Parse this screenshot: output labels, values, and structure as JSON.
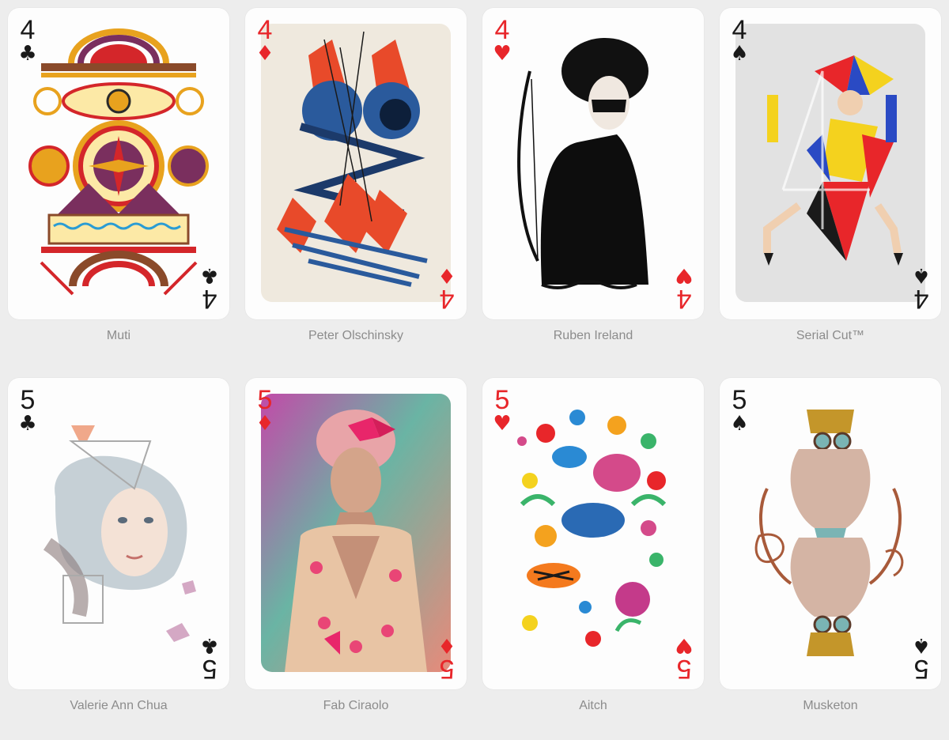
{
  "colors": {
    "red": "#e8262a",
    "black": "#1a1a1a",
    "caption": "#8c8c8c",
    "background": "#ededed"
  },
  "cards": [
    {
      "rank": "4",
      "suit": "♣",
      "suit_name": "clubs",
      "artist": "Muti",
      "art": "geometric-folk-pattern"
    },
    {
      "rank": "4",
      "suit": "♦",
      "suit_name": "diamonds",
      "artist": "Peter Olschinsky",
      "art": "abstract-splatter"
    },
    {
      "rank": "4",
      "suit": "♥",
      "suit_name": "hearts",
      "artist": "Ruben Ireland",
      "art": "archer-silhouette"
    },
    {
      "rank": "4",
      "suit": "♠",
      "suit_name": "spades",
      "artist": "Serial Cut™",
      "art": "geometric-figure"
    },
    {
      "rank": "5",
      "suit": "♣",
      "suit_name": "clubs",
      "artist": "Valerie Ann Chua",
      "art": "watercolor-portrait"
    },
    {
      "rank": "5",
      "suit": "♦",
      "suit_name": "diamonds",
      "artist": "Fab Ciraolo",
      "art": "floral-portrait"
    },
    {
      "rank": "5",
      "suit": "♥",
      "suit_name": "hearts",
      "artist": "Aitch",
      "art": "animal-flora"
    },
    {
      "rank": "5",
      "suit": "♠",
      "suit_name": "spades",
      "artist": "Musketon",
      "art": "bearded-wizard"
    }
  ]
}
